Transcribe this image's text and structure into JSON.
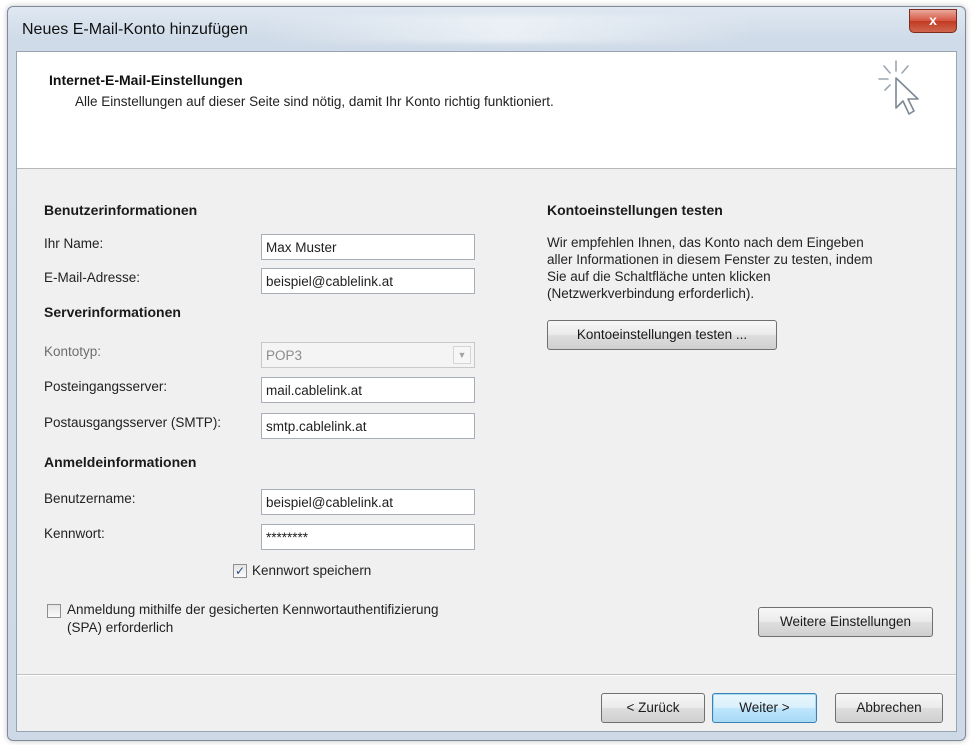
{
  "window": {
    "title": "Neues E-Mail-Konto hinzufügen",
    "close_label": "x"
  },
  "header": {
    "title": "Internet-E-Mail-Einstellungen",
    "subtitle": "Alle Einstellungen auf dieser Seite sind nötig, damit Ihr Konto richtig funktioniert.",
    "icon": "wizard-cursor-icon"
  },
  "user_info": {
    "heading": "Benutzerinformationen",
    "name_label": "Ihr Name:",
    "name_value": "Max Muster",
    "email_label": "E-Mail-Adresse:",
    "email_value": "beispiel@cablelink.at"
  },
  "server_info": {
    "heading": "Serverinformationen",
    "account_type_label": "Kontotyp:",
    "account_type_value": "POP3",
    "incoming_label": "Posteingangsserver:",
    "incoming_value": "mail.cablelink.at",
    "outgoing_label": "Postausgangsserver (SMTP):",
    "outgoing_value": "smtp.cablelink.at"
  },
  "login_info": {
    "heading": "Anmeldeinformationen",
    "username_label": "Benutzername:",
    "username_value": "beispiel@cablelink.at",
    "password_label": "Kennwort:",
    "password_value": "********",
    "remember_label": "Kennwort speichern",
    "remember_checked": true,
    "spa_label_line1": "Anmeldung mithilfe der gesicherten Kennwortauthentifizierung",
    "spa_label_line2": "(SPA) erforderlich",
    "spa_checked": false
  },
  "test_section": {
    "heading": "Kontoeinstellungen testen",
    "description_line1": "Wir empfehlen Ihnen, das Konto nach dem Eingeben",
    "description_line2": "aller Informationen in diesem Fenster zu testen, indem",
    "description_line3": "Sie auf die Schaltfläche unten klicken",
    "description_line4": "(Netzwerkverbindung erforderlich).",
    "test_button": "Kontoeinstellungen testen ..."
  },
  "more_settings_button": "Weitere Einstellungen",
  "footer": {
    "back": "< Zurück",
    "next": "Weiter >",
    "cancel": "Abbrechen"
  },
  "colors": {
    "default_button_border": "#3c7fb1",
    "checkmark": "#2a4a86",
    "close_button": "#c13b22"
  }
}
